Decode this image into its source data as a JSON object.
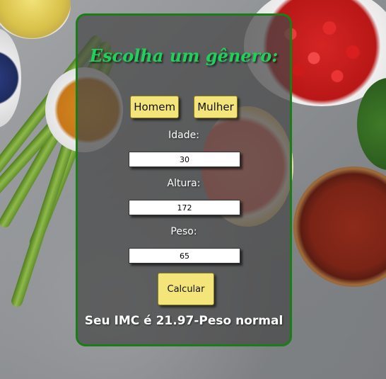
{
  "form": {
    "title": "Escolha um gênero:",
    "gender_buttons": [
      "Homem",
      "Mulher"
    ],
    "age_label": "Idade:",
    "age_value": "30",
    "height_label": "Altura:",
    "height_value": "172",
    "weight_label": "Peso:",
    "weight_value": "65",
    "calculate_label": "Calcular",
    "result_text": "Seu IMC é 21.97-Peso normal"
  },
  "colors": {
    "title": "#1fd15a",
    "panel_border": "#1a7d1a",
    "button": "#f4e57a"
  }
}
